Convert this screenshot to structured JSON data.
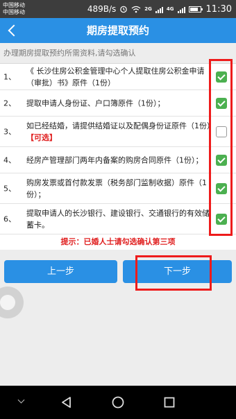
{
  "status_bar": {
    "carrier_1": "中国移动",
    "carrier_2": "中国移动",
    "speed": "489B/s",
    "network_1": "2G",
    "network_2": "4G",
    "time": "11:30"
  },
  "header": {
    "title": "期房提取预约"
  },
  "intro": "办理期房提取预约所需资料,请勾选确认",
  "items": [
    {
      "num": "1、",
      "text": "《 长沙住房公积金管理中心个人提取住房公积金申请（审批）书》原件（1份）",
      "checked": true
    },
    {
      "num": "2、",
      "text": "提取申请人身份证、户口簿原件（1份）；",
      "checked": true
    },
    {
      "num": "3、",
      "text": "如已经结婚，请提供结婚证以及配偶身份证原件（1份）",
      "optional": "【可选】",
      "checked": false
    },
    {
      "num": "4、",
      "text": "经房产管理部门两年内备案的购房合同原件（1份）；",
      "checked": true
    },
    {
      "num": "5、",
      "text": "购房发票或首付款发票（税务部门监制收据）原件（1份）；",
      "checked": true
    },
    {
      "num": "6、",
      "text": "提取申请人的长沙银行、建设银行、交通银行的有效储蓄卡。",
      "checked": true
    }
  ],
  "hint": "提示：已婚人士请勾选确认第三项",
  "buttons": {
    "prev": "上一步",
    "next": "下一步"
  },
  "colors": {
    "accent": "#2a90e4",
    "check_green": "#4cb050",
    "hint_red": "#e02020",
    "annotation_red": "#ee1b1b"
  },
  "icons": {
    "back": "chevron-left-icon",
    "nav_down": "chevron-down-icon",
    "nav_back": "triangle-back-icon",
    "nav_home": "circle-home-icon",
    "nav_recent": "square-recent-icon"
  }
}
